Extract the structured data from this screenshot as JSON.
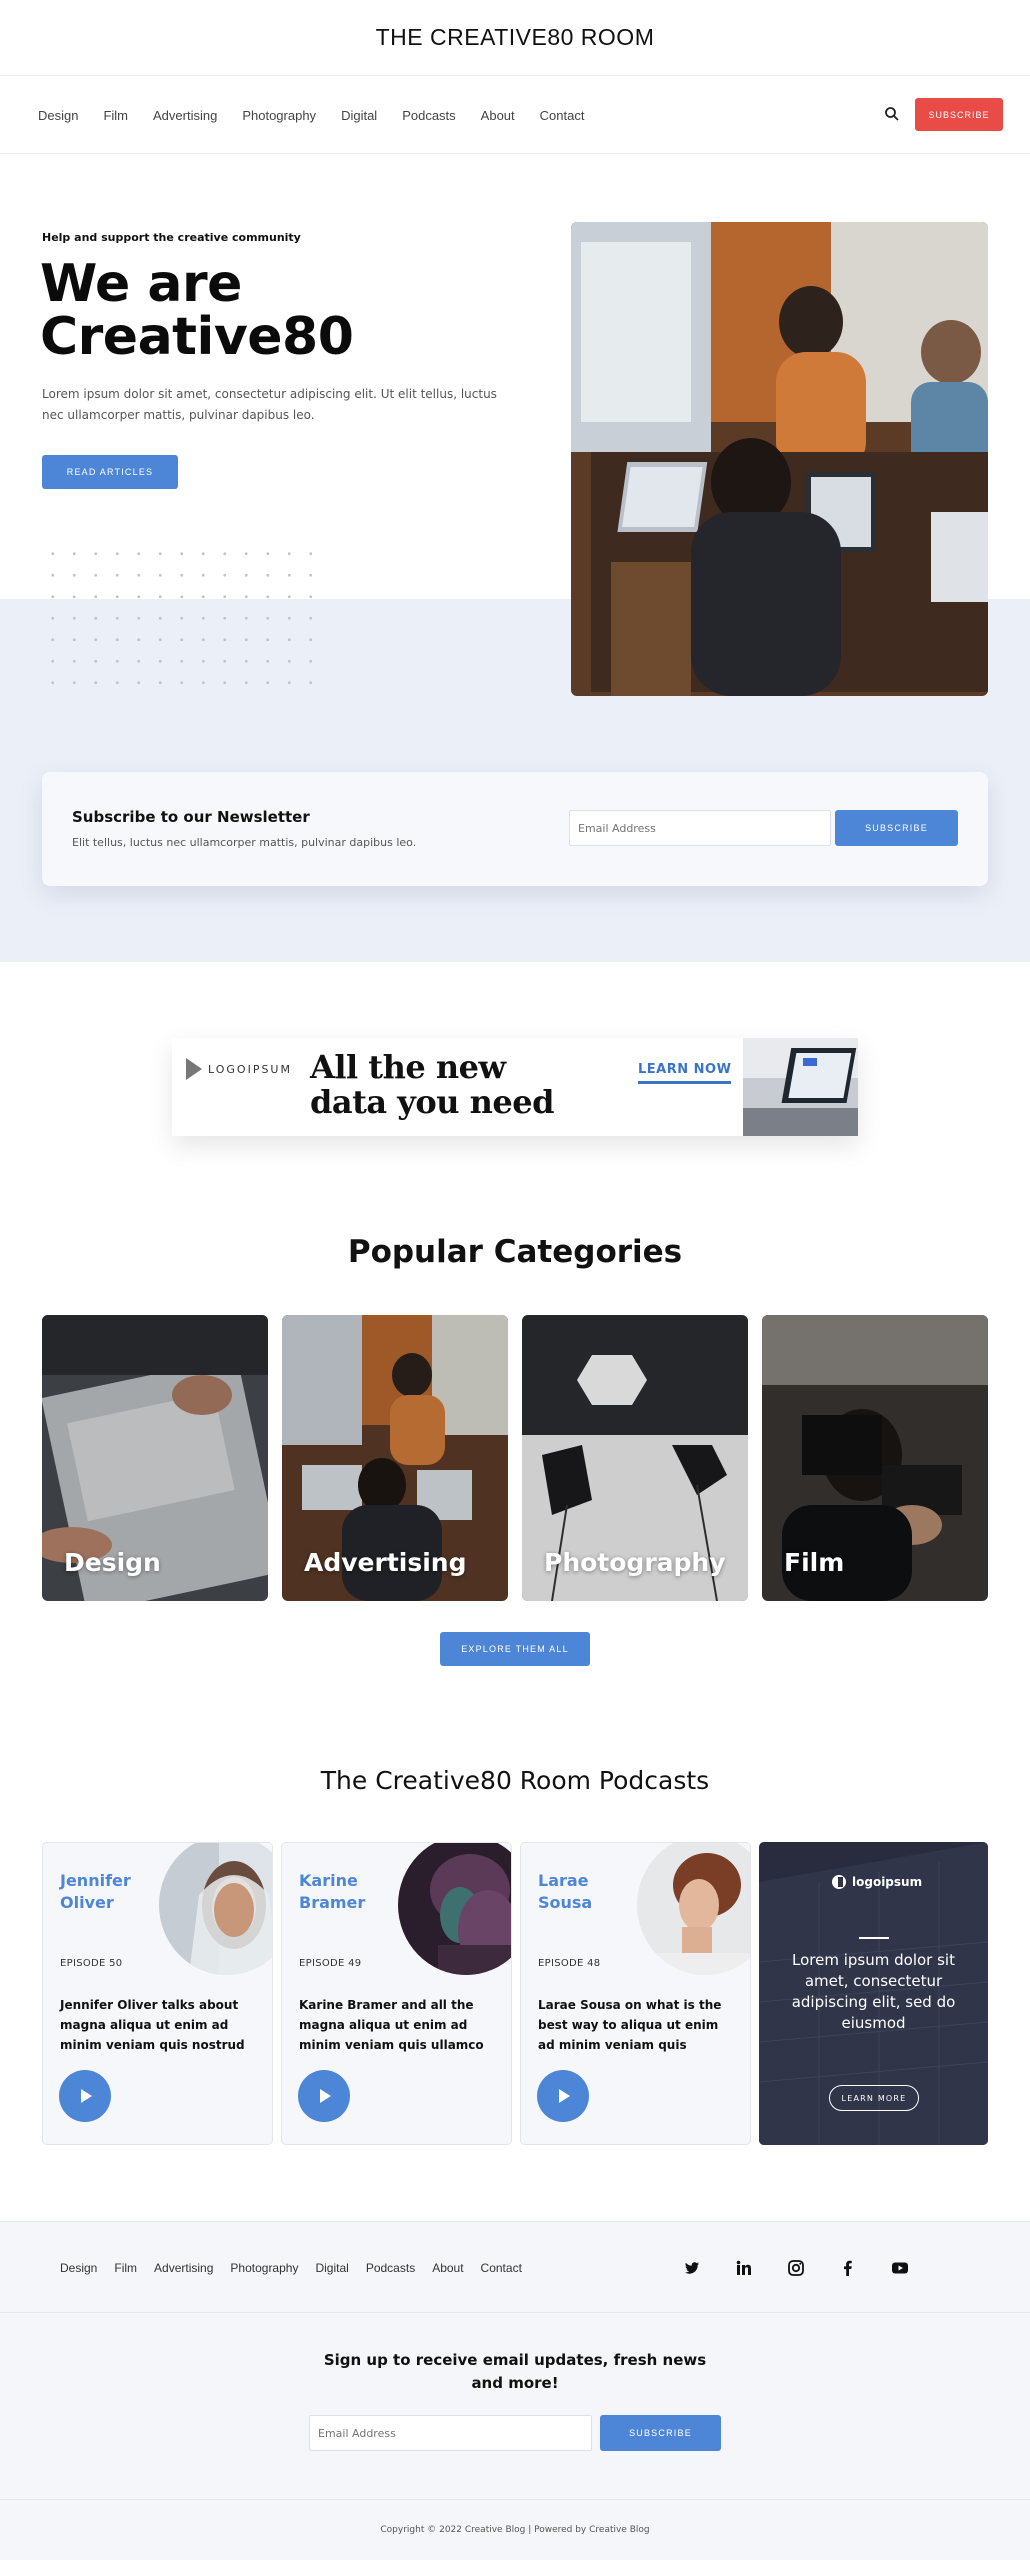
{
  "site": {
    "title": "THE CREATIVE80 ROOM"
  },
  "nav": {
    "items": [
      "Design",
      "Film",
      "Advertising",
      "Photography",
      "Digital",
      "Podcasts",
      "About",
      "Contact"
    ],
    "subscribe_label": "SUBSCRIBE",
    "search_icon": "search-icon"
  },
  "hero": {
    "kicker": "Help and support the creative community",
    "title": "We are Creative80",
    "text": "Lorem ipsum dolor sit amet, consectetur adipiscing elit. Ut elit tellus, luctus nec ullamcorper mattis, pulvinar dapibus leo.",
    "button_label": "READ ARTICLES"
  },
  "newsletter": {
    "title": "Subscribe to our Newsletter",
    "text": "Elit tellus, luctus nec ullamcorper mattis, pulvinar dapibus leo.",
    "placeholder": "Email Address",
    "button_label": "SUBSCRIBE"
  },
  "ad": {
    "logo_text": "LOGOIPSUM",
    "headline": "All the new data you need",
    "link_label": "LEARN NOW"
  },
  "categories": {
    "heading": "Popular Categories",
    "items": [
      "Design",
      "Advertising",
      "Photography",
      "Film"
    ],
    "button_label": "EXPLORE THEM ALL"
  },
  "podcasts": {
    "heading": "The Creative80 Room Podcasts",
    "items": [
      {
        "name": "Jennifer Oliver",
        "episode": "EPISODE 50",
        "desc": "Jennifer Oliver talks about magna aliqua ut enim ad minim veniam quis nostrud"
      },
      {
        "name": "Karine Bramer",
        "episode": "EPISODE 49",
        "desc": "Karine Bramer and all the magna aliqua ut enim ad minim veniam quis ullamco"
      },
      {
        "name": "Larae Sousa",
        "episode": "EPISODE 48",
        "desc": "Larae Sousa on what is the best way to aliqua ut enim ad minim veniam quis"
      }
    ],
    "promo": {
      "logo_text": "logoipsum",
      "text": "Lorem ipsum dolor sit amet, consectetur adipiscing elit, sed do eiusmod",
      "button_label": "LEARN MORE"
    }
  },
  "footer": {
    "nav_items": [
      "Design",
      "Film",
      "Advertising",
      "Photography",
      "Digital",
      "Podcasts",
      "About",
      "Contact"
    ],
    "social_icons": [
      "twitter-icon",
      "linkedin-icon",
      "instagram-icon",
      "facebook-icon",
      "youtube-icon"
    ],
    "signup_title": "Sign up to receive email updates, fresh news and more!",
    "placeholder": "Email Address",
    "button_label": "SUBSCRIBE",
    "copyright": "Copyright © 2022 Creative Blog | Powered by Creative Blog"
  },
  "colors": {
    "accent": "#4d86d6",
    "subscribe": "#e94b47",
    "hero_bg": "#ebeff7"
  }
}
